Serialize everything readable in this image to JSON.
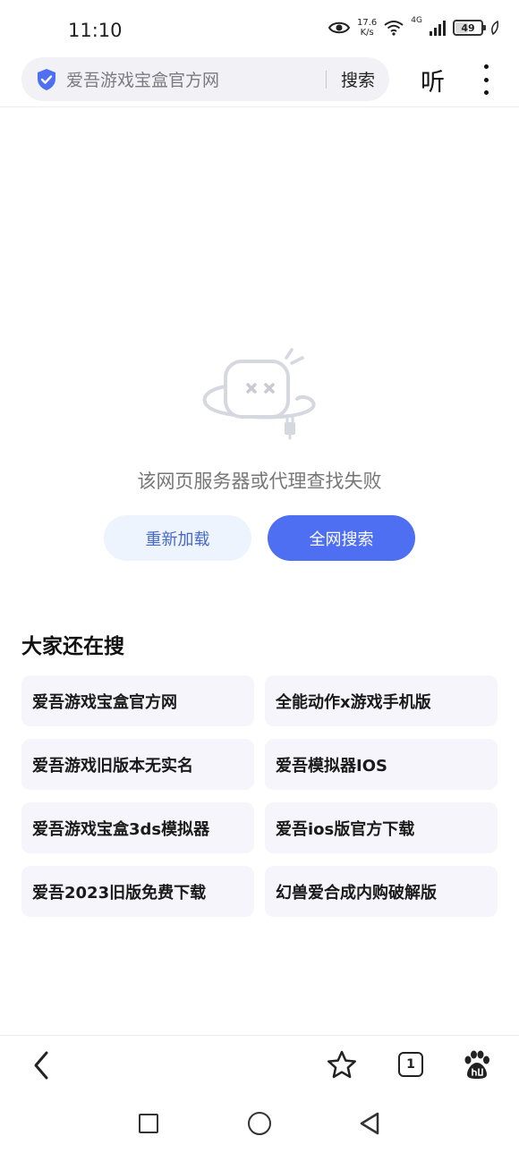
{
  "status_bar": {
    "time": "11:10",
    "speed_value": "17.6",
    "speed_unit": "K/s",
    "network": "4G",
    "battery": "49"
  },
  "search_bar": {
    "query": "爱吾游戏宝盒官方网",
    "search_label": "搜索",
    "shield_icon": "shield-check-icon",
    "brand_color": "#4e6ff2"
  },
  "toolbar_top": {
    "listen_label": "听",
    "more_icon": "more-vertical-icon"
  },
  "error": {
    "message": "该网页服务器或代理查找失败",
    "reload_label": "重新加载",
    "web_search_label": "全网搜索"
  },
  "suggestions": {
    "title": "大家还在搜",
    "items": [
      "爱吾游戏宝盒官方网",
      "全能动作x游戏手机版",
      "爱吾游戏旧版本无实名",
      "爱吾模拟器IOS",
      "爱吾游戏宝盒3ds模拟器",
      "爱吾ios版官方下载",
      "爱吾2023旧版免费下载",
      "幻兽爱合成内购破解版"
    ]
  },
  "bottom_toolbar": {
    "tab_count": "1",
    "icons": [
      "back-arrow-icon",
      "star-icon",
      "tabs-icon",
      "baidu-paw-icon"
    ]
  },
  "system_nav": {
    "icons": [
      "recents-square-icon",
      "home-circle-icon",
      "back-triangle-icon"
    ]
  }
}
